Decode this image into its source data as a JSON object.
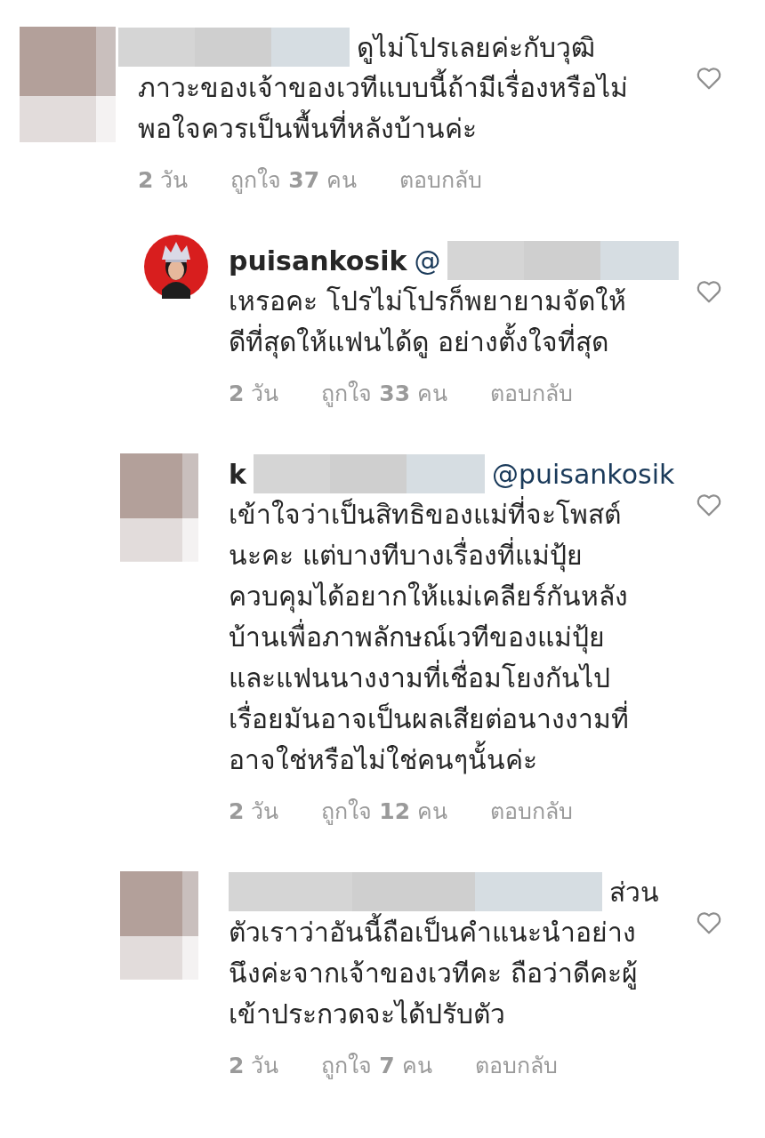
{
  "comments": [
    {
      "reply": false,
      "avatar": {
        "kind": "blurred"
      },
      "header": [
        {
          "kind": "redacted_short"
        },
        {
          "kind": "text",
          "text": "ดูไม่โปรเลยค่ะกับวุฒิ"
        }
      ],
      "lines": [
        "ภาวะของเจ้าของเวทีแบบนี้ถ้ามีเรื่องหรือไม่",
        "พอใจควรเป็นพื้นที่หลังบ้านค่ะ"
      ],
      "meta": {
        "time": "**2** วัน",
        "likes": "ถูกใจ **37** คน",
        "reply_label": "ตอบกลับ"
      }
    },
    {
      "reply": true,
      "avatar": {
        "kind": "picture"
      },
      "header": [
        {
          "kind": "username",
          "text": "puisankosik"
        },
        {
          "kind": "mention",
          "text": "@"
        },
        {
          "kind": "redacted_short"
        }
      ],
      "lines": [
        "เหรอคะ โปรไม่โปรก็พยายามจัดให้",
        "ดีที่สุดให้แฟนได้ดู อย่างตั้งใจที่สุด"
      ],
      "meta": {
        "time": "**2** วัน",
        "likes": "ถูกใจ **33** คน",
        "reply_label": "ตอบกลับ"
      }
    },
    {
      "reply": true,
      "avatar": {
        "kind": "blurred"
      },
      "header": [
        {
          "kind": "username",
          "text": "k"
        },
        {
          "kind": "redacted_short"
        },
        {
          "kind": "mention",
          "text": "@puisankosik"
        }
      ],
      "lines": [
        "เข้าใจว่าเป็นสิทธิของแม่ที่จะโพสต์",
        "นะคะ แต่บางทีบางเรื่องที่แม่ปุ้ย",
        "ควบคุมได้อยากให้แม่เคลียร์กันหลัง",
        "บ้านเพื่อภาพลักษณ์เวทีของแม่ปุ้ย",
        "และแฟนนางงามที่เชื่อมโยงกันไป",
        "เรื่อยมันอาจเป็นผลเสียต่อนางงามที่",
        "อาจใช่หรือไม่ใช่คนๆนั้นค่ะ"
      ],
      "meta": {
        "time": "**2** วัน",
        "likes": "ถูกใจ **12** คน",
        "reply_label": "ตอบกลับ"
      }
    },
    {
      "reply": true,
      "avatar": {
        "kind": "blurred"
      },
      "header": [
        {
          "kind": "redacted_long"
        },
        {
          "kind": "text",
          "text": "ส่วน"
        }
      ],
      "lines": [
        "ตัวเราว่าอันนี้ถือเป็นคำแนะนำอย่าง",
        "นึงค่ะจากเจ้าของเวทีคะ ถือว่าดีคะผู้",
        "เข้าประกวดจะได้ปรับตัว"
      ],
      "meta": {
        "time": "**2** วัน",
        "likes": "ถูกใจ **7** คน",
        "reply_label": "ตอบกลับ"
      }
    }
  ]
}
